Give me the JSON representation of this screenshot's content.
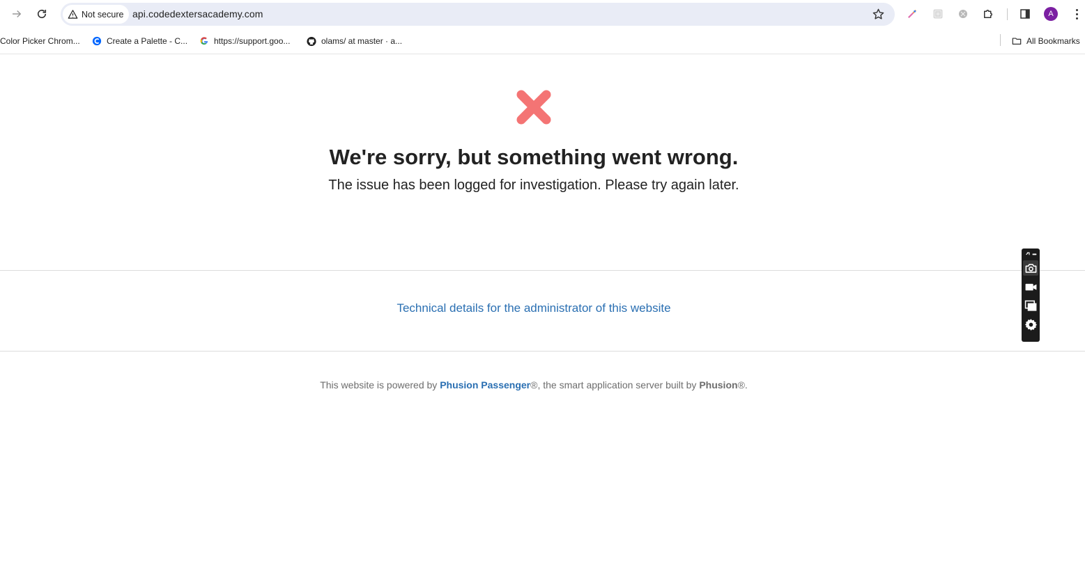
{
  "browser": {
    "security_label": "Not secure",
    "url": "api.codedextersacademy.com",
    "avatar_letter": "A"
  },
  "bookmarks": {
    "items": [
      {
        "label": "Color Picker Chrom..."
      },
      {
        "label": "Create a Palette - C..."
      },
      {
        "label": "https://support.goo..."
      },
      {
        "label": "olams/ at master · a..."
      }
    ],
    "all_bookmarks": "All Bookmarks"
  },
  "page": {
    "headline": "We're sorry, but something went wrong.",
    "subline": "The issue has been logged for investigation. Please try again later.",
    "tech_link": "Technical details for the administrator of this website",
    "footer": {
      "prefix": "This website is powered by ",
      "passenger": "Phusion Passenger",
      "middle": "®, the smart application server built by ",
      "phusion": "Phusion",
      "suffix": "®."
    },
    "error_icon_color": "#f47474",
    "link_color": "#2a6fb2"
  }
}
